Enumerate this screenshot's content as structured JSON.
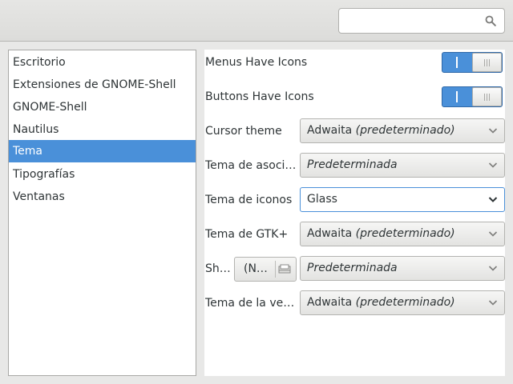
{
  "search": {
    "value": "",
    "placeholder": ""
  },
  "sidebar": {
    "items": [
      {
        "label": "Escritorio"
      },
      {
        "label": "Extensiones de GNOME-Shell"
      },
      {
        "label": "GNOME-Shell"
      },
      {
        "label": "Nautilus"
      },
      {
        "label": "Tema",
        "selected": true
      },
      {
        "label": "Tipografías"
      },
      {
        "label": "Ventanas"
      }
    ]
  },
  "settings": {
    "menus_icons": {
      "label": "Menus Have Icons",
      "state": "on"
    },
    "buttons_icons": {
      "label": "Buttons Have Icons",
      "state": "on"
    },
    "cursor_theme": {
      "label": "Cursor theme",
      "value": "Adwaita",
      "suffix": "(predeterminado)"
    },
    "sound_theme": {
      "label": "Tema de asoci…",
      "value": "Predeterminada"
    },
    "icon_theme": {
      "label": "Tema de iconos",
      "value": "Glass"
    },
    "gtk_theme": {
      "label": "Tema de GTK+",
      "value": "Adwaita",
      "suffix": "(predeterminado)"
    },
    "shell_theme": {
      "label": "Sh…",
      "button_label": "(N…",
      "value": "Predeterminada"
    },
    "window_theme": {
      "label": "Tema de la ve…",
      "value": "Adwaita",
      "suffix": "(predeterminado)"
    }
  },
  "icons": {
    "search": "search-icon",
    "combo_arrow": "chevron-down-icon",
    "file_chooser": "folder-icon"
  },
  "colors": {
    "accent": "#4a90d9",
    "selected_text": "#ffffff"
  }
}
